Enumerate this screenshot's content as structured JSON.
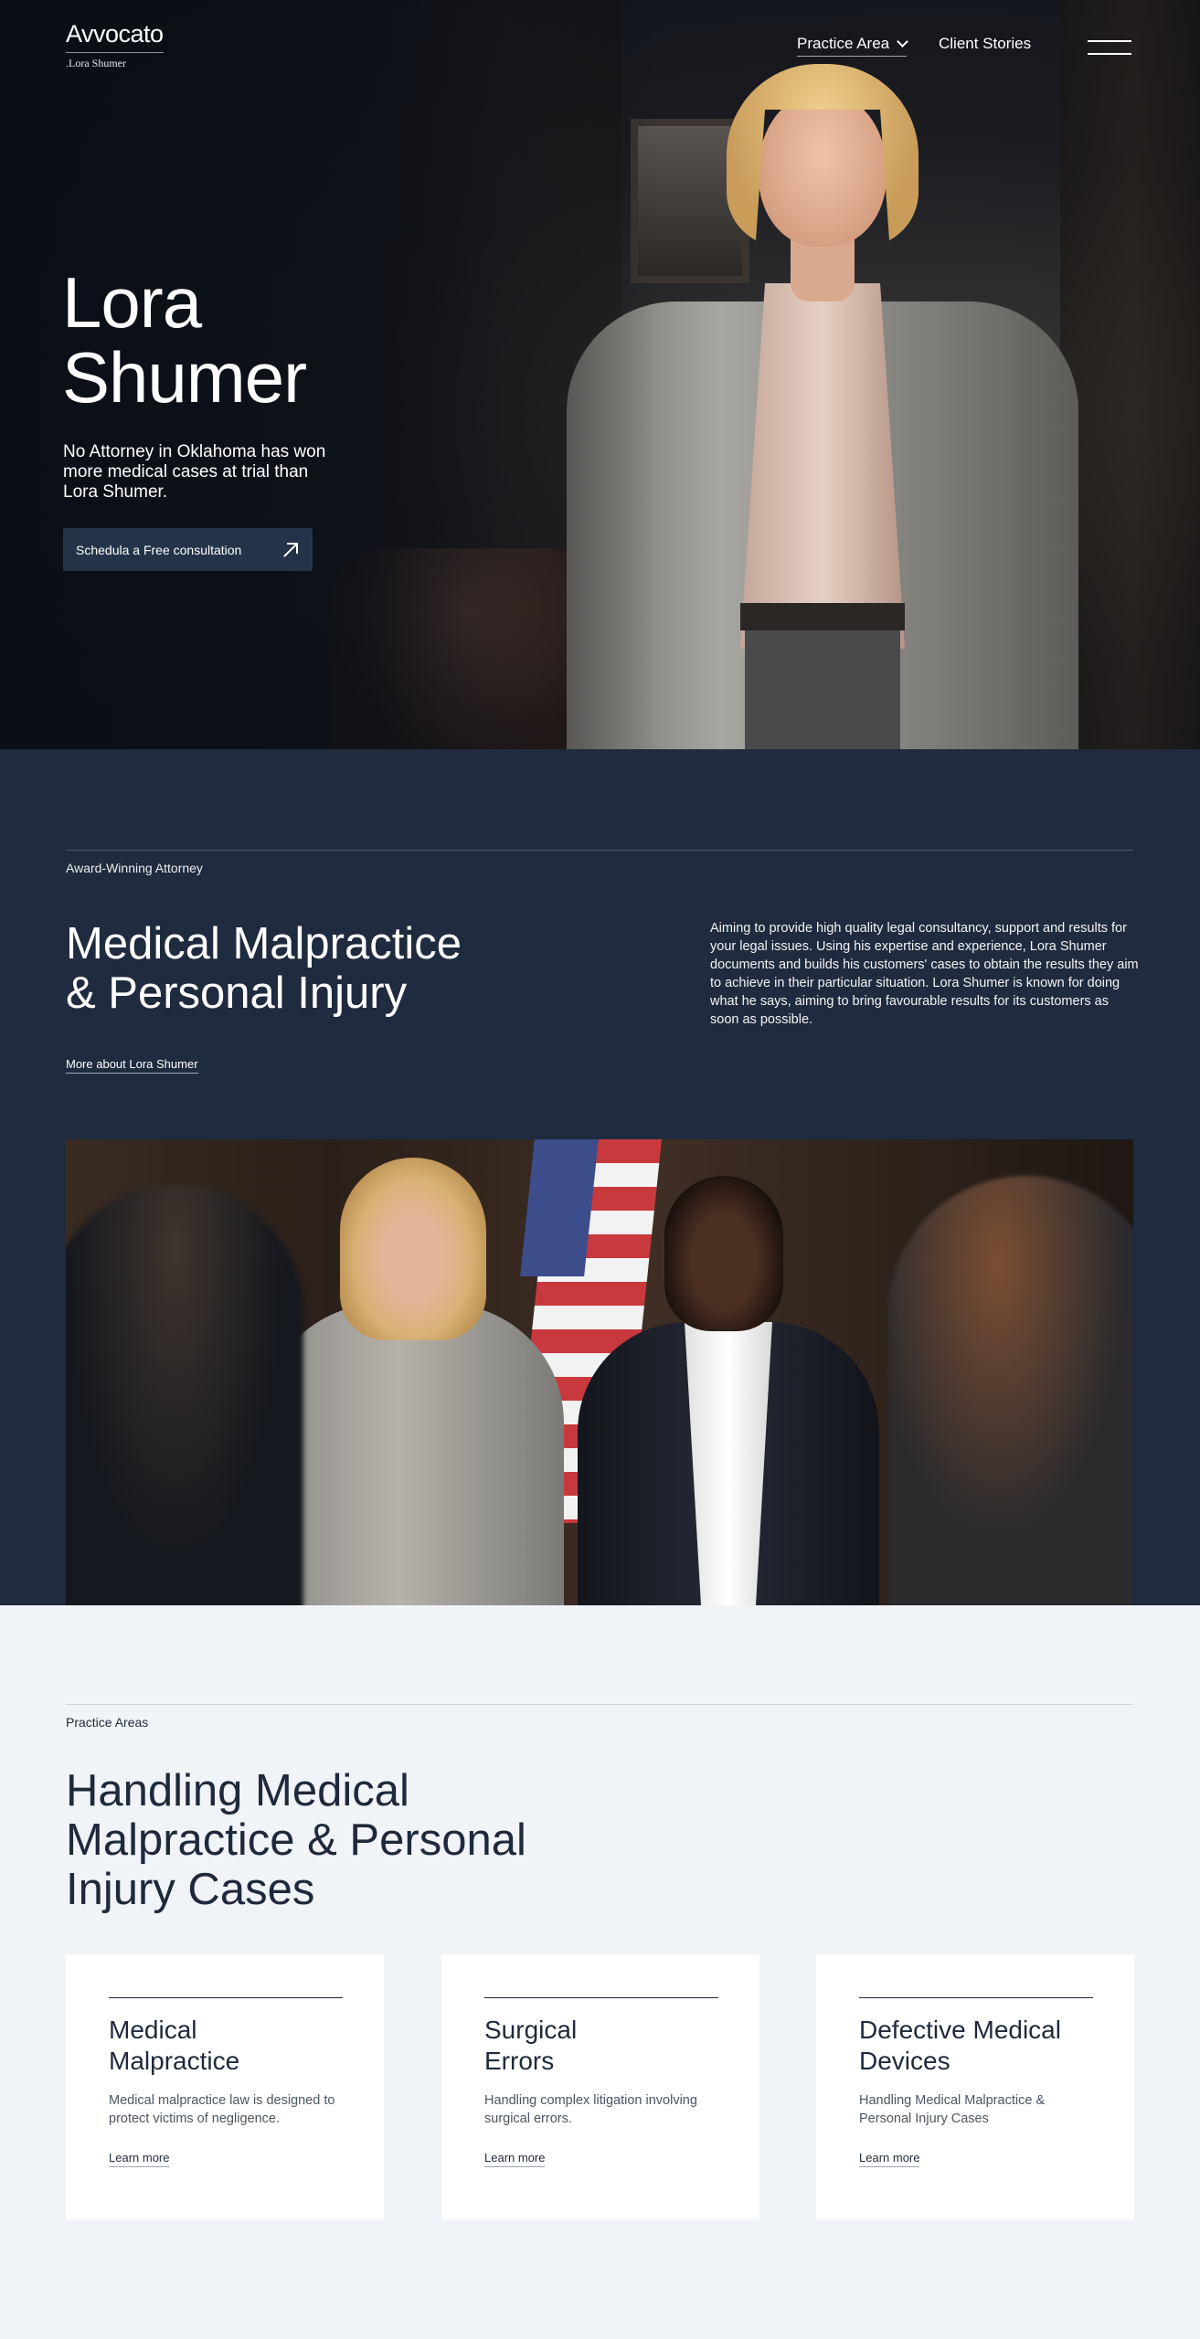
{
  "brand": {
    "name": "Avvocato",
    "tagline": ".Lora Shumer"
  },
  "nav": {
    "practice_area": "Practice Area",
    "client_stories": "Client Stories"
  },
  "hero": {
    "title_line1": "Lora",
    "title_line2": "Shumer",
    "text": "No Attorney in Oklahoma has won more medical cases at trial than Lora Shumer.",
    "cta_label": "Schedula a Free consultation"
  },
  "about": {
    "eyebrow": "Award-Winning Attorney",
    "heading_line1": "Medical Malpractice",
    "heading_line2": "& Personal Injury",
    "paragraph": "Aiming to provide high quality legal consultancy, support and results for your legal issues. Using his expertise and experience, Lora Shumer documents and builds his customers' cases to obtain the  results they aim to achieve in their particular situation. Lora Shumer is known for doing what he says, aiming to bring favourable results for its customers as soon as possible.",
    "more_link": "More about Lora Shumer"
  },
  "practice": {
    "eyebrow": "Practice Areas",
    "heading_line1": "Handling Medical",
    "heading_line2": "Malpractice & Personal",
    "heading_line3": "Injury Cases",
    "cards": [
      {
        "title_line1": "Medical",
        "title_line2": "Malpractice",
        "desc": "Medical malpractice law is designed to protect victims of negligence.",
        "link": "Learn more"
      },
      {
        "title_line1": "Surgical",
        "title_line2": "Errors",
        "desc": "Handling complex litigation involving surgical errors.",
        "link": "Learn more"
      },
      {
        "title_line1": "Defective Medical",
        "title_line2": "Devices",
        "desc": "Handling Medical Malpractice & Personal Injury Cases",
        "link": "Learn more"
      }
    ]
  },
  "colors": {
    "hero_bg": "#0c1018",
    "about_bg": "#1f2b3e",
    "page_bg": "#f0f3f7",
    "cta_bg": "#243448",
    "text_dark": "#1e293b"
  }
}
